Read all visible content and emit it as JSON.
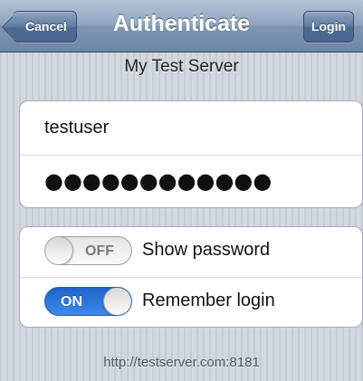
{
  "navbar": {
    "title": "Authenticate",
    "cancel_label": "Cancel",
    "login_label": "Login"
  },
  "server_name": "My Test Server",
  "credentials": {
    "username": "testuser",
    "password_mask": "●●●●●●●●●●●●"
  },
  "options": [
    {
      "label": "Show password",
      "switch_text": "OFF",
      "on": false
    },
    {
      "label": "Remember login",
      "switch_text": "ON",
      "on": true
    }
  ],
  "footer_url": "http://testserver.com:8181",
  "colors": {
    "nav_bar": "#7d95b1",
    "switch_on": "#2f76da",
    "background": "#cbd2d8"
  }
}
